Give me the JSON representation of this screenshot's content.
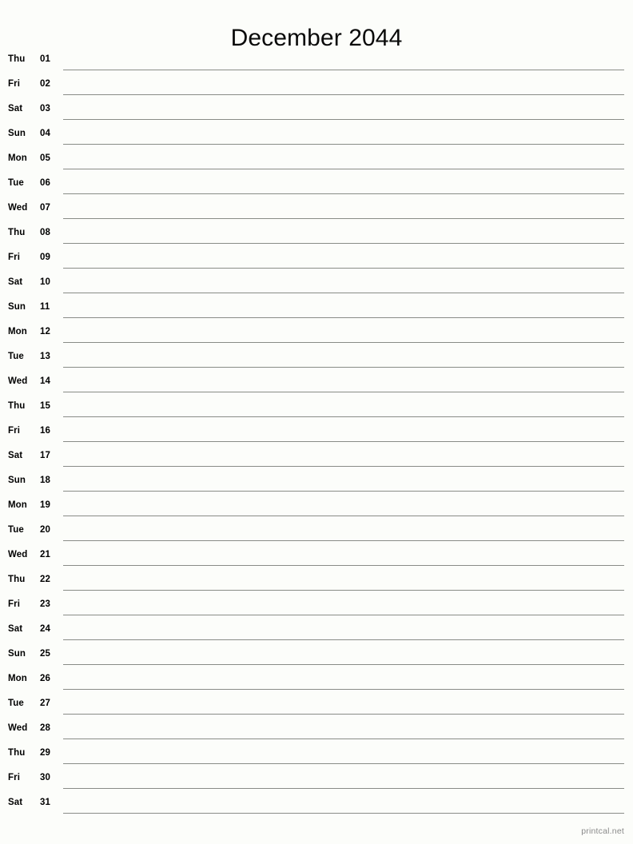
{
  "document": {
    "title": "December 2044",
    "month": "December",
    "year": "2044",
    "layout": "single-column-notes-calendar",
    "line_color": "#898c87",
    "background_color": "#fcfdfa",
    "text_color": "#000000"
  },
  "footer": {
    "credit": "printcal.net",
    "color": "#8a8a8a"
  },
  "days": [
    {
      "weekday": "Thu",
      "number": "01"
    },
    {
      "weekday": "Fri",
      "number": "02"
    },
    {
      "weekday": "Sat",
      "number": "03"
    },
    {
      "weekday": "Sun",
      "number": "04"
    },
    {
      "weekday": "Mon",
      "number": "05"
    },
    {
      "weekday": "Tue",
      "number": "06"
    },
    {
      "weekday": "Wed",
      "number": "07"
    },
    {
      "weekday": "Thu",
      "number": "08"
    },
    {
      "weekday": "Fri",
      "number": "09"
    },
    {
      "weekday": "Sat",
      "number": "10"
    },
    {
      "weekday": "Sun",
      "number": "11"
    },
    {
      "weekday": "Mon",
      "number": "12"
    },
    {
      "weekday": "Tue",
      "number": "13"
    },
    {
      "weekday": "Wed",
      "number": "14"
    },
    {
      "weekday": "Thu",
      "number": "15"
    },
    {
      "weekday": "Fri",
      "number": "16"
    },
    {
      "weekday": "Sat",
      "number": "17"
    },
    {
      "weekday": "Sun",
      "number": "18"
    },
    {
      "weekday": "Mon",
      "number": "19"
    },
    {
      "weekday": "Tue",
      "number": "20"
    },
    {
      "weekday": "Wed",
      "number": "21"
    },
    {
      "weekday": "Thu",
      "number": "22"
    },
    {
      "weekday": "Fri",
      "number": "23"
    },
    {
      "weekday": "Sat",
      "number": "24"
    },
    {
      "weekday": "Sun",
      "number": "25"
    },
    {
      "weekday": "Mon",
      "number": "26"
    },
    {
      "weekday": "Tue",
      "number": "27"
    },
    {
      "weekday": "Wed",
      "number": "28"
    },
    {
      "weekday": "Thu",
      "number": "29"
    },
    {
      "weekday": "Fri",
      "number": "30"
    },
    {
      "weekday": "Sat",
      "number": "31"
    }
  ]
}
